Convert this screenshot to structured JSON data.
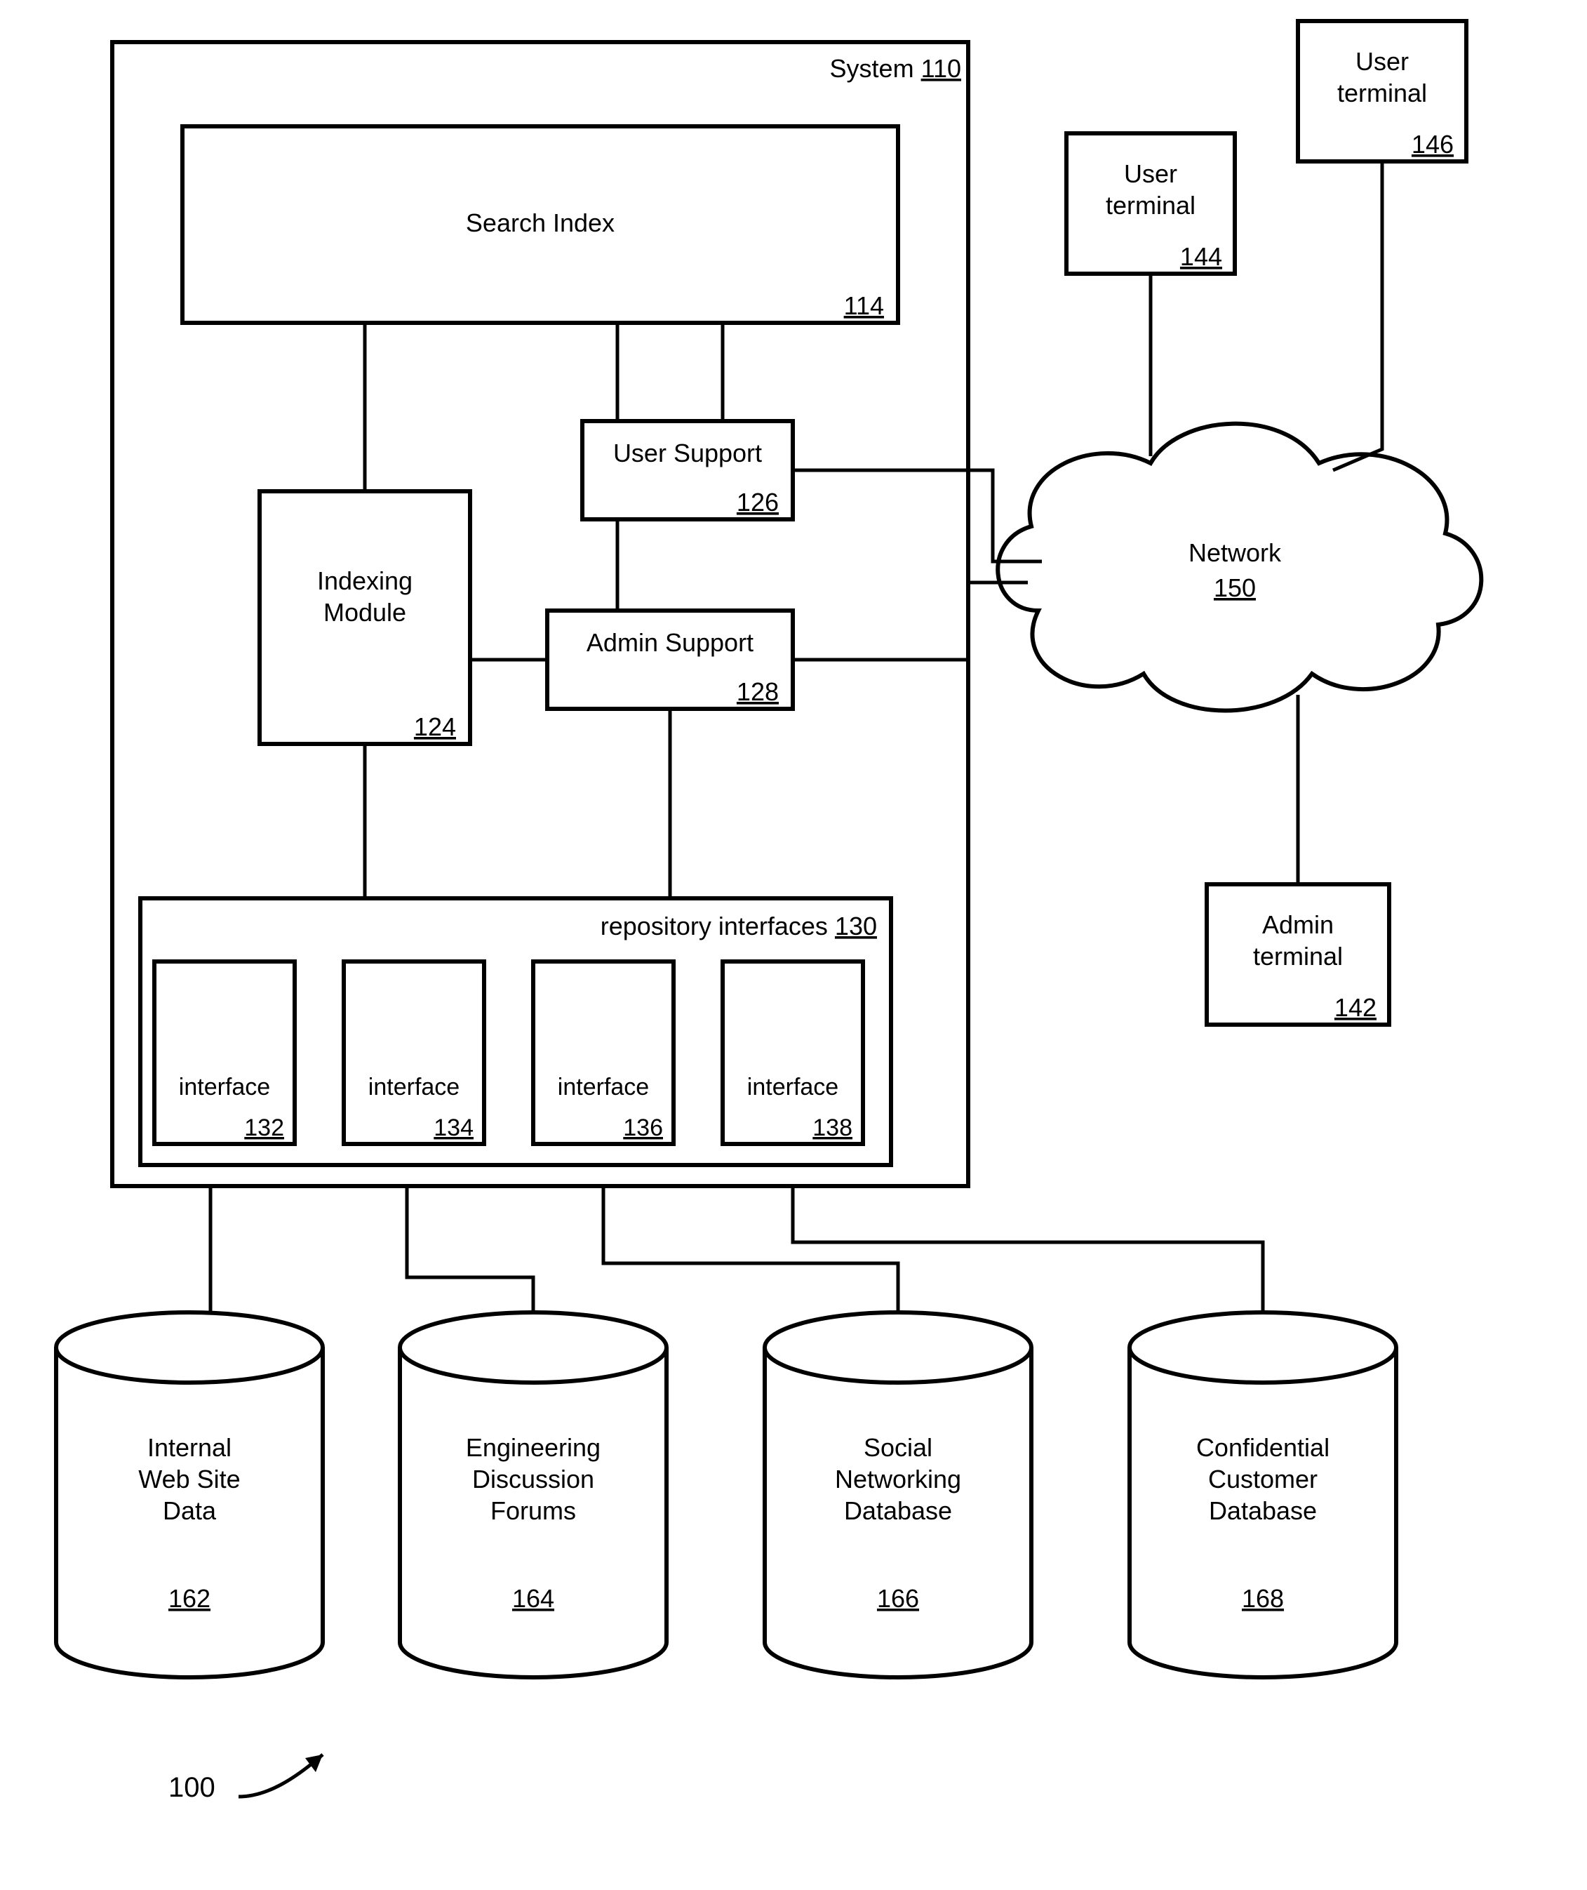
{
  "figure_ref": "100",
  "system": {
    "label": "System",
    "ref": "110"
  },
  "search_index": {
    "label": "Search Index",
    "ref": "114"
  },
  "indexing_module": {
    "label1": "Indexing",
    "label2": "Module",
    "ref": "124"
  },
  "user_support": {
    "label": "User Support",
    "ref": "126"
  },
  "admin_support": {
    "label": "Admin Support",
    "ref": "128"
  },
  "repo_interfaces": {
    "label": "repository interfaces",
    "ref": "130"
  },
  "interfaces": [
    {
      "label": "interface",
      "ref": "132"
    },
    {
      "label": "interface",
      "ref": "134"
    },
    {
      "label": "interface",
      "ref": "136"
    },
    {
      "label": "interface",
      "ref": "138"
    }
  ],
  "network": {
    "label": "Network",
    "ref": "150"
  },
  "user_terminal_1": {
    "label1": "User",
    "label2": "terminal",
    "ref": "144"
  },
  "user_terminal_2": {
    "label1": "User",
    "label2": "terminal",
    "ref": "146"
  },
  "admin_terminal": {
    "label1": "Admin",
    "label2": "terminal",
    "ref": "142"
  },
  "cylinders": [
    {
      "l1": "Internal",
      "l2": "Web Site",
      "l3": "Data",
      "ref": "162"
    },
    {
      "l1": "Engineering",
      "l2": "Discussion",
      "l3": "Forums",
      "ref": "164"
    },
    {
      "l1": "Social",
      "l2": "Networking",
      "l3": "Database",
      "ref": "166"
    },
    {
      "l1": "Confidential",
      "l2": "Customer",
      "l3": "Database",
      "ref": "168"
    }
  ]
}
